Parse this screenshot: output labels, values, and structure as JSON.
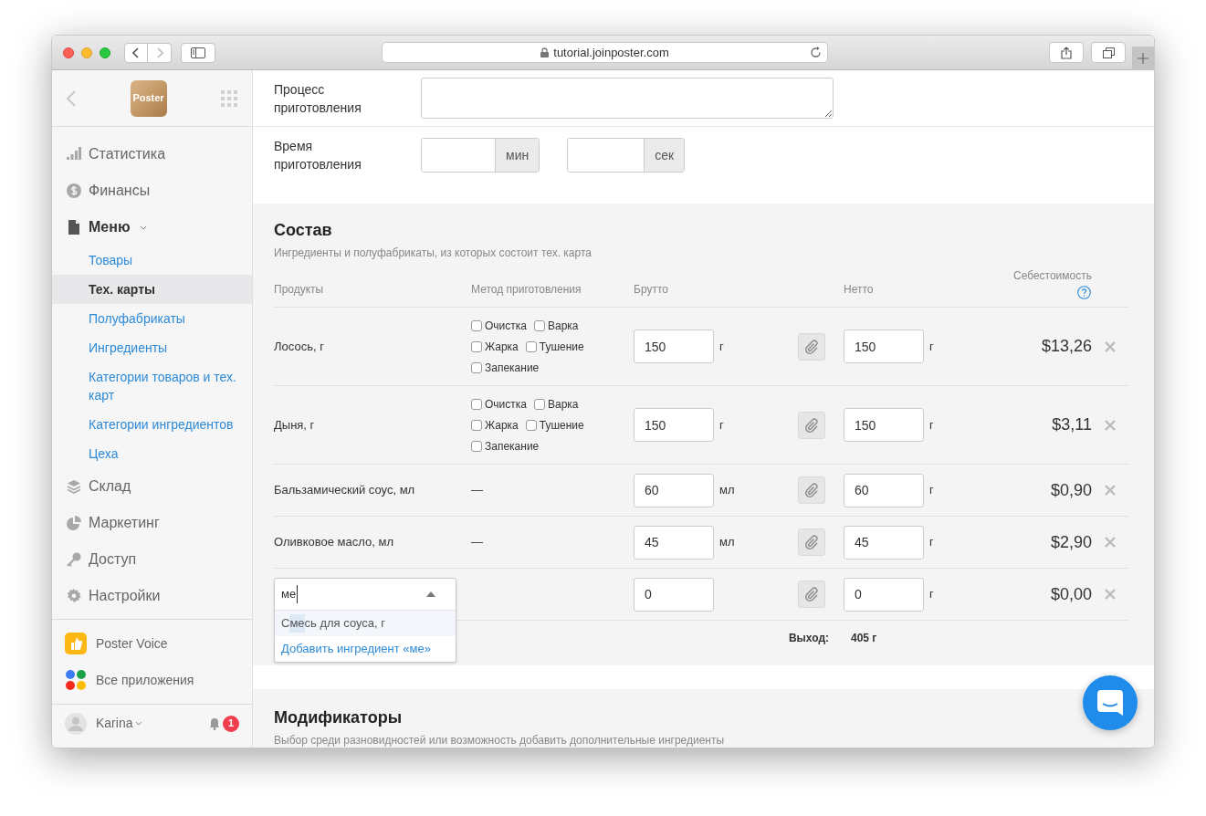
{
  "browser": {
    "url": "tutorial.joinposter.com"
  },
  "sidebar": {
    "logo": "Poster",
    "nav": [
      {
        "label": "Статистика",
        "expanded": false
      },
      {
        "label": "Финансы",
        "expanded": false
      },
      {
        "label": "Меню",
        "expanded": true,
        "children": [
          {
            "label": "Товары",
            "selected": false
          },
          {
            "label": "Тех. карты",
            "selected": true
          },
          {
            "label": "Полуфабрикаты",
            "selected": false
          },
          {
            "label": "Ингредиенты",
            "selected": false
          },
          {
            "label": "Категории товаров и тех. карт",
            "selected": false
          },
          {
            "label": "Категории ингредиентов",
            "selected": false
          },
          {
            "label": "Цеха",
            "selected": false
          }
        ]
      },
      {
        "label": "Склад",
        "expanded": false
      },
      {
        "label": "Маркетинг",
        "expanded": false
      },
      {
        "label": "Доступ",
        "expanded": false
      },
      {
        "label": "Настройки",
        "expanded": false
      }
    ],
    "apps": [
      {
        "label": "Poster Voice"
      },
      {
        "label": "Все приложения"
      }
    ],
    "user": {
      "name": "Karina",
      "notifications": "1"
    }
  },
  "cooking": {
    "process_label": "Процесс приготовления",
    "time_label": "Время приготовления",
    "time_units": [
      "мин",
      "сек"
    ]
  },
  "composition": {
    "title": "Состав",
    "subtitle": "Ингредиенты и полуфабрикаты, из которых состоит тех. карта",
    "columns": [
      "Продукты",
      "Метод приготовления",
      "Брутто",
      "Нетто",
      "Себестоимость"
    ],
    "rows": [
      {
        "kind": "product",
        "name": "Лосось, г",
        "methods": [
          {
            "label": "Очистка",
            "checked": false
          },
          {
            "label": "Варка",
            "checked": false
          },
          {
            "label": "Жарка",
            "checked": false
          },
          {
            "label": "Тушение",
            "checked": false
          },
          {
            "label": "Запекание",
            "checked": false
          }
        ],
        "gross": "150",
        "gross_unit": "г",
        "net": "150",
        "net_unit": "г",
        "cost": "$13,26"
      },
      {
        "kind": "product",
        "name": "Дыня, г",
        "methods": [
          {
            "label": "Очистка",
            "checked": false
          },
          {
            "label": "Варка",
            "checked": false
          },
          {
            "label": "Жарка",
            "checked": false
          },
          {
            "label": "Тушение",
            "checked": false
          },
          {
            "label": "Запекание",
            "checked": false
          }
        ],
        "gross": "150",
        "gross_unit": "г",
        "net": "150",
        "net_unit": "г",
        "cost": "$3,11"
      },
      {
        "kind": "product",
        "name": "Бальзамический соус, мл",
        "method": "—",
        "gross": "60",
        "gross_unit": "мл",
        "net": "60",
        "net_unit": "г",
        "cost": "$0,90"
      },
      {
        "kind": "product",
        "name": "Оливковое масло, мл",
        "method": "—",
        "gross": "45",
        "gross_unit": "мл",
        "net": "45",
        "net_unit": "г",
        "cost": "$2,90"
      },
      {
        "kind": "search",
        "query": "ме",
        "suggestions": [
          {
            "before": "С",
            "match": "ме",
            "after": "сь для соуса, г",
            "highlighted": true
          }
        ],
        "add_link": "Добавить ингредиент «ме»",
        "gross": "0",
        "net": "0",
        "net_unit": "г",
        "cost": "$0,00"
      }
    ],
    "yield_label": "Выход:",
    "yield_value": "405 г"
  },
  "modifiers": {
    "title": "Модификаторы",
    "subtitle": "Выбор среди разновидностей или возможность добавить дополнительные ингредиенты"
  }
}
